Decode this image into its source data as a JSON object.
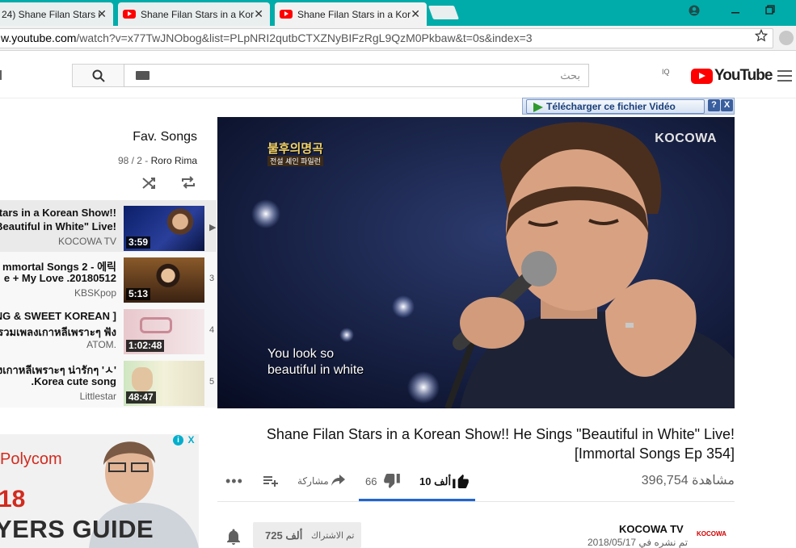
{
  "browser": {
    "tabs": [
      {
        "label": "24) Shane Filan Stars i",
        "close": "✕"
      },
      {
        "label": "Shane Filan Stars in a Kor",
        "close": "✕"
      },
      {
        "label": "Shane Filan Stars in a Kor",
        "close": "✕"
      }
    ],
    "url_prefix": "w.youtube.com",
    "url_rest": "/watch?v=x77TwJNObog&list=PLpNRI2qutbCTXZNyBIFzRgL9QzM0Pkbaw&t=0s&index=3",
    "bookmark_icon": "star-icon"
  },
  "header": {
    "search_placeholder": "بحث",
    "country_code": "IQ",
    "logo_text": "YouTube"
  },
  "downloader": {
    "label": "Télécharger ce fichier Vidéo",
    "help": "?",
    "close": "X"
  },
  "playlist": {
    "title": "Fav. Songs",
    "position": "98 / 2 -",
    "owner": "Roro Rima",
    "items": [
      {
        "line1": "tars in a Korean Show!!",
        "line2": "Beautiful in White\" Live!",
        "channel": "KOCOWA TV",
        "duration": "3:59",
        "index": "▶"
      },
      {
        "line1": "mmortal Songs 2 - 에릭",
        "line2": "e + My Love .20180512",
        "channel": "KBSKpop",
        "duration": "5:13",
        "index": "3"
      },
      {
        "line1": "NG & SWEET KOREAN ]",
        "line2": "รวมเพลงเกาหลีเพราะๆ ฟัง",
        "channel": "ATOM.",
        "duration": "1:02:48",
        "index": "4"
      },
      {
        "line1": "งเกาหลีเพราะๆ น่ารักๆ 'ㅅ'",
        "line2": ".Korea cute song",
        "channel": "Littlestar",
        "duration": "48:47",
        "index": "5"
      }
    ]
  },
  "video": {
    "watermark": "KOCOWA",
    "show_logo": "불후의명곡",
    "show_sub": "전설 셰인 파일런",
    "subtitle_line1": "You look so",
    "subtitle_line2": "beautiful in white"
  },
  "ad": {
    "brand": "Polycom",
    "big_text_1": "18",
    "big_text_2": "YERS GUIDE",
    "info": "i",
    "close": "X"
  },
  "watch": {
    "title_line1": "Shane Filan Stars in a Korean Show!! He Sings \"Beautiful in White\" Live!",
    "title_line2": "[Immortal Songs Ep 354]",
    "views": "396,754 مشاهدة",
    "likes": "10 ألف",
    "dislikes": "66",
    "share": "مشاركة"
  },
  "channel": {
    "name": "KOCOWA TV",
    "published": "تم نشره في 2018/05/17",
    "avatar_text": "KOCOWA",
    "subscribe_label": "تم الاشتراك",
    "subscriber_count": "725 ألف"
  },
  "colors": {
    "tabstrip": "#00aca9",
    "youtube_red": "#ff0000",
    "like_bar": "#2065d1"
  }
}
